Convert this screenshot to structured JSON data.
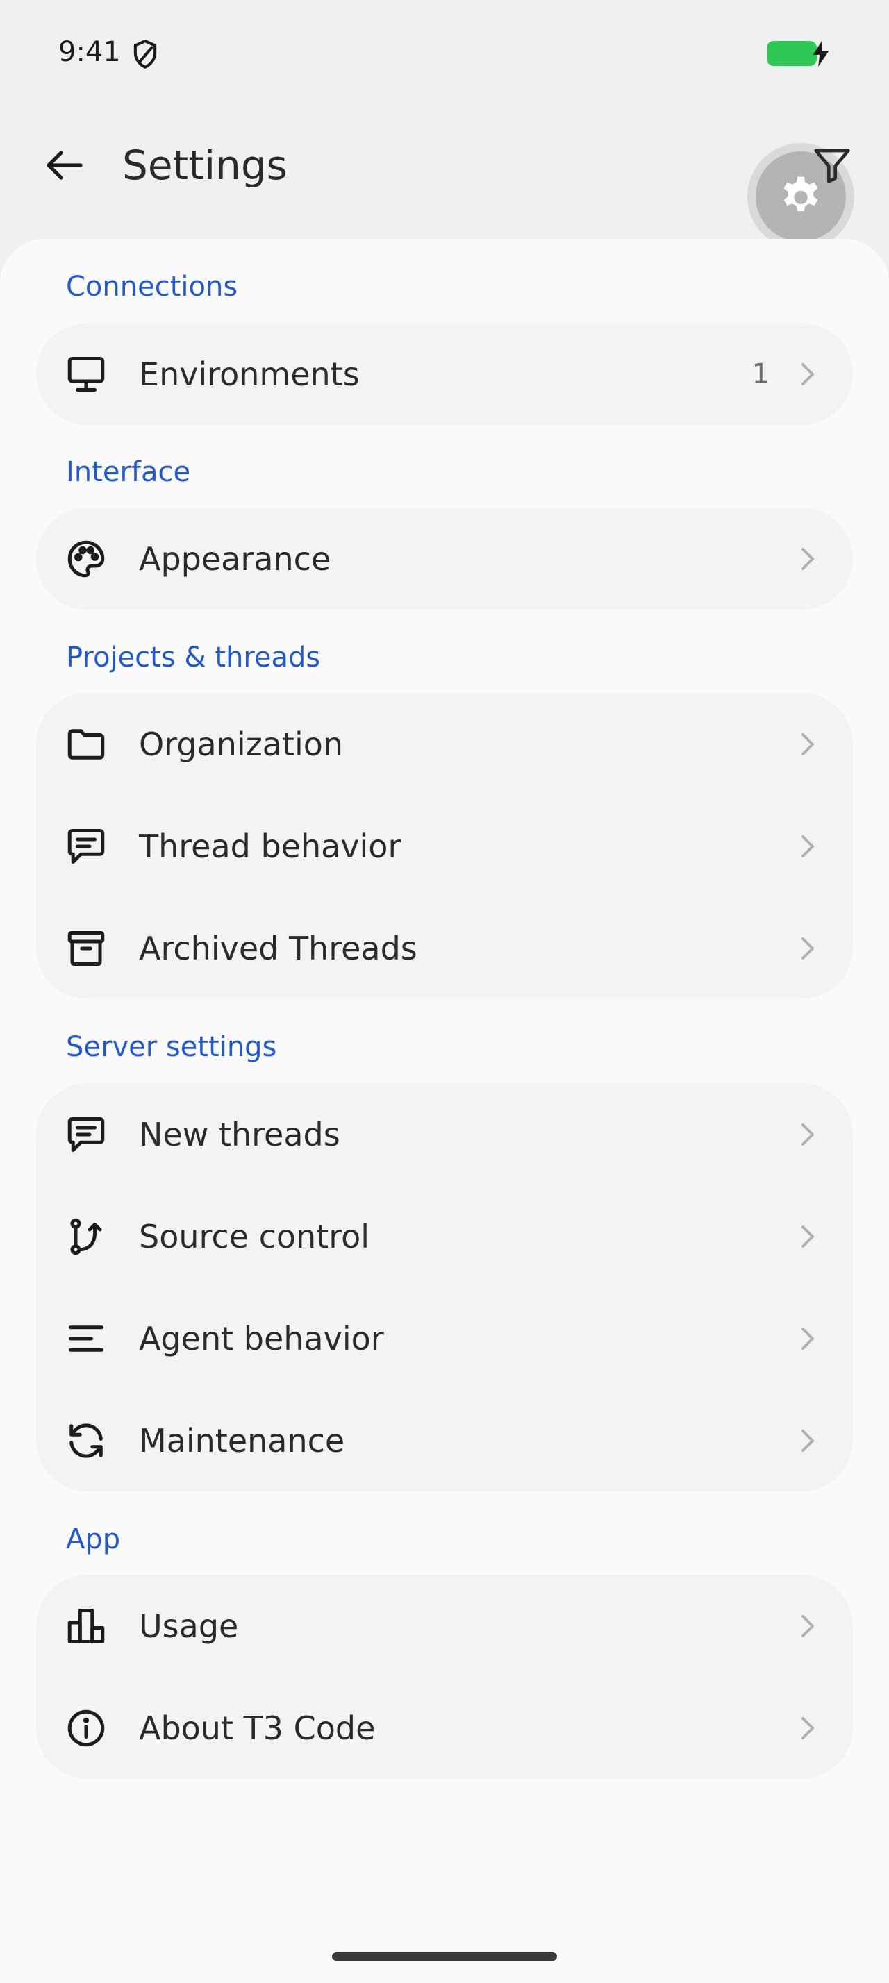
{
  "status_bar": {
    "time": "9:41",
    "shield_icon": "shield-icon",
    "battery_color": "#2ec955"
  },
  "header": {
    "title": "Settings",
    "back_icon": "arrow-left-icon",
    "filter_icon": "filter-icon",
    "fab_icon": "gear-icon"
  },
  "accent": "#2158d6",
  "sections": {
    "connections": {
      "label": "Connections",
      "items": [
        {
          "label": "Environments",
          "count": "1",
          "icon": "monitor-icon"
        }
      ]
    },
    "interface": {
      "label": "Interface",
      "items": [
        {
          "label": "Appearance",
          "icon": "palette-icon"
        }
      ]
    },
    "projects": {
      "label": "Projects & threads",
      "items": [
        {
          "label": "Organization",
          "icon": "folder-icon"
        },
        {
          "label": "Thread behavior",
          "icon": "chat-icon"
        },
        {
          "label": "Archived Threads",
          "icon": "archive-icon"
        }
      ]
    },
    "server": {
      "label": "Server settings",
      "items": [
        {
          "label": "New threads",
          "icon": "chat-icon"
        },
        {
          "label": "Source control",
          "icon": "git-branch-icon"
        },
        {
          "label": "Agent behavior",
          "icon": "align-left-icon"
        },
        {
          "label": "Maintenance",
          "icon": "refresh-icon"
        }
      ]
    },
    "app": {
      "label": "App",
      "items": [
        {
          "label": "Usage",
          "icon": "bar-chart-icon"
        },
        {
          "label": "About T3 Code",
          "icon": "info-icon"
        }
      ]
    }
  }
}
